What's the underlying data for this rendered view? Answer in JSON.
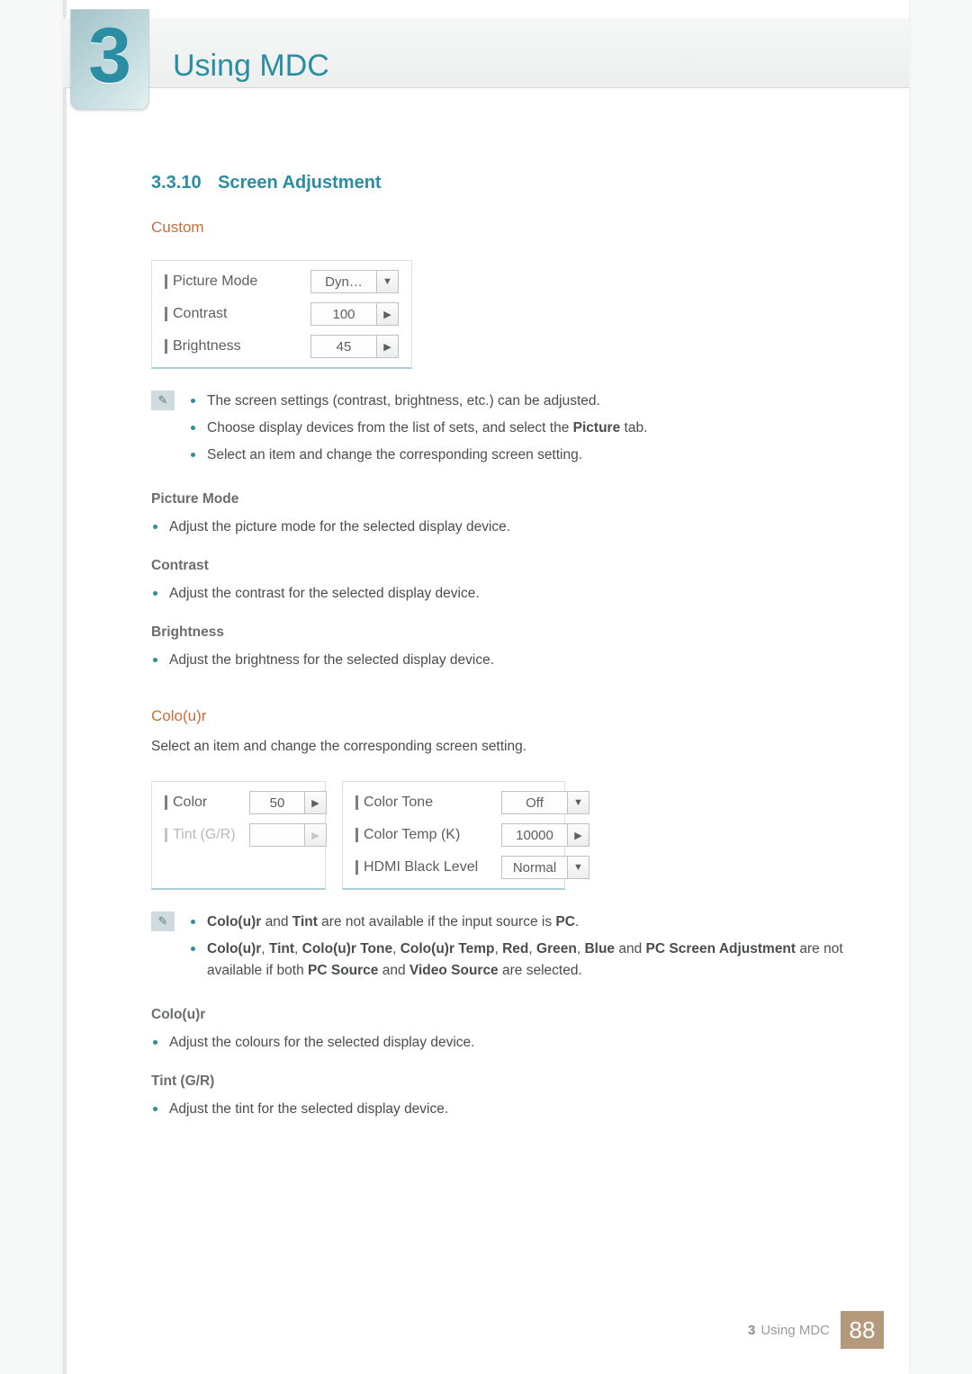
{
  "header": {
    "chapter_number": "3",
    "title": "Using MDC"
  },
  "section": {
    "number": "3.3.10",
    "title": "Screen Adjustment"
  },
  "custom": {
    "heading": "Custom",
    "rows": {
      "picture_mode": {
        "label": "Picture Mode",
        "value": "Dyn…"
      },
      "contrast": {
        "label": "Contrast",
        "value": "100"
      },
      "brightness": {
        "label": "Brightness",
        "value": "45"
      }
    },
    "notes": [
      "The screen settings (contrast, brightness, etc.) can be adjusted.",
      "Choose display devices from the list of sets, and select the Picture tab.",
      "Select an item and change the corresponding screen setting."
    ],
    "note_bold": {
      "picture": "Picture"
    },
    "items": {
      "picture_mode": {
        "head": "Picture Mode",
        "body": "Adjust the picture mode for the selected display device."
      },
      "contrast": {
        "head": "Contrast",
        "body": "Adjust the contrast for the selected display device."
      },
      "brightness": {
        "head": "Brightness",
        "body": "Adjust the brightness for the selected display device."
      }
    }
  },
  "colour": {
    "heading": "Colo(u)r",
    "intro": "Select an item and change the corresponding screen setting.",
    "left": {
      "color": {
        "label": "Color",
        "value": "50"
      },
      "tint": {
        "label": "Tint (G/R)",
        "value": ""
      }
    },
    "right": {
      "color_tone": {
        "label": "Color Tone",
        "value": "Off"
      },
      "color_temp": {
        "label": "Color Temp (K)",
        "value": "10000"
      },
      "hdmi_black": {
        "label": "HDMI Black Level",
        "value": "Normal"
      }
    },
    "notes": {
      "n1_pre": "",
      "n1_b1": "Colo(u)r",
      "n1_mid1": " and ",
      "n1_b2": "Tint",
      "n1_post": " are not available if the input source is ",
      "n1_b3": "PC",
      "n1_end": ".",
      "n2_b1": "Colo(u)r",
      "n2_s1": ", ",
      "n2_b2": "Tint",
      "n2_s2": ", ",
      "n2_b3": "Colo(u)r Tone",
      "n2_s3": ", ",
      "n2_b4": "Colo(u)r Temp",
      "n2_s4": ", ",
      "n2_b5": "Red",
      "n2_s5": ", ",
      "n2_b6": "Green",
      "n2_s6": ", ",
      "n2_b7": "Blue",
      "n2_s7": " and ",
      "n2_b8": "PC Screen Adjustment",
      "n2_tail1": " are not available if both ",
      "n2_b9": "PC Source",
      "n2_tail2": " and ",
      "n2_b10": "Video Source",
      "n2_tail3": " are selected."
    },
    "items": {
      "colour": {
        "head": "Colo(u)r",
        "body": "Adjust the colours for the selected display device."
      },
      "tint": {
        "head": "Tint (G/R)",
        "body": "Adjust the tint for the selected display device."
      }
    }
  },
  "footer": {
    "chapter_num": "3",
    "chapter_title": "Using MDC",
    "page": "88"
  },
  "glyphs": {
    "dropdown": "▼",
    "spinner": "▶",
    "note_icon": "✎"
  }
}
